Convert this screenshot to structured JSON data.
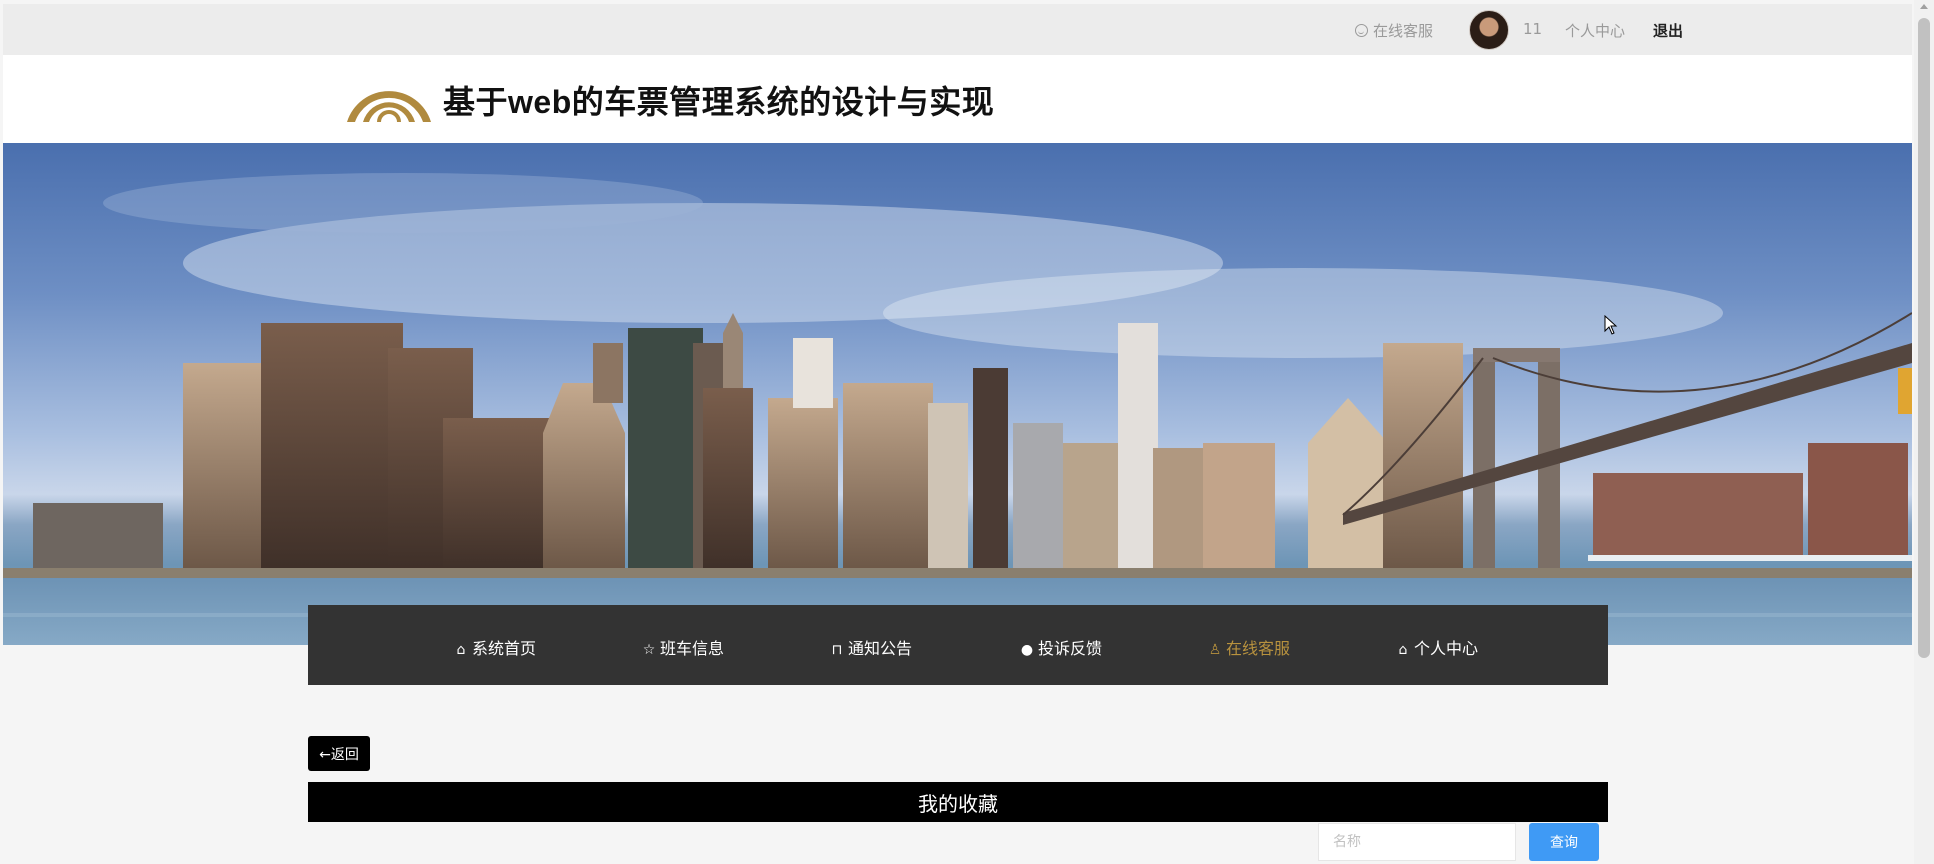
{
  "topbar": {
    "service_label": "在线客服",
    "user_id": "11",
    "profile_label": "个人中心",
    "logout_label": "退出"
  },
  "header": {
    "title": "基于web的车票管理系统的设计与实现"
  },
  "colors": {
    "accent_gold": "#b8923e",
    "nav_bg": "#333333",
    "search_button": "#3f9af5"
  },
  "nav": {
    "items": [
      {
        "label": "系统首页",
        "icon": "home-icon"
      },
      {
        "label": "班车信息",
        "icon": "star-icon"
      },
      {
        "label": "通知公告",
        "icon": "bag-icon"
      },
      {
        "label": "投诉反馈",
        "icon": "alert-icon"
      },
      {
        "label": "在线客服",
        "icon": "user-icon",
        "active": true
      },
      {
        "label": "个人中心",
        "icon": "home-icon"
      }
    ]
  },
  "content": {
    "back_label": "←返回",
    "section_title": "我的收藏",
    "search_placeholder": "名称",
    "search_button": "查询"
  }
}
